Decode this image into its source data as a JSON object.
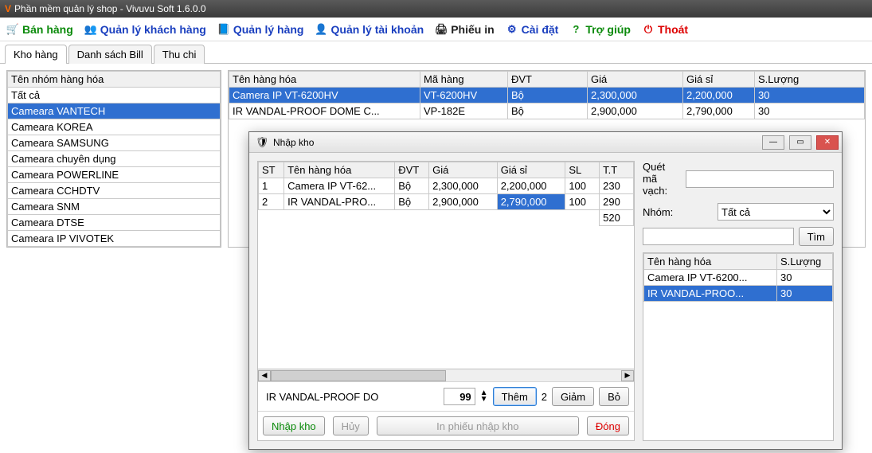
{
  "window": {
    "title": "Phần mềm quản lý shop - Vivuvu Soft 1.6.0.0"
  },
  "toolbar": {
    "sell": "Bán hàng",
    "customers": "Quản lý khách hàng",
    "inventory": "Quản lý hàng",
    "accounts": "Quản lý tài khoản",
    "printslip": "Phiếu in",
    "settings": "Cài đặt",
    "help": "Trợ giúp",
    "exit": "Thoát"
  },
  "tabs": {
    "warehouse": "Kho hàng",
    "bills": "Danh sách Bill",
    "cash": "Thu chi"
  },
  "groups": {
    "header": "Tên nhóm hàng hóa",
    "items": [
      "Tất cả",
      "Cameara VANTECH",
      "Cameara KOREA",
      "Cameara SAMSUNG",
      "Cameara chuyên dụng",
      "Cameara POWERLINE",
      "Cameara CCHDTV",
      "Cameara SNM",
      "Cameara DTSE",
      "Cameara IP VIVOTEK"
    ],
    "selected_index": 1
  },
  "products_table": {
    "headers": {
      "name": "Tên hàng hóa",
      "code": "Mã hàng",
      "unit": "ĐVT",
      "price": "Giá",
      "wprice": "Giá sỉ",
      "qty": "S.Lượng"
    },
    "rows": [
      {
        "name": "Camera IP VT-6200HV",
        "code": "VT-6200HV",
        "unit": "Bộ",
        "price": "2,300,000",
        "wprice": "2,200,000",
        "qty": "30",
        "selected": true
      },
      {
        "name": "IR VANDAL-PROOF DOME C...",
        "code": "VP-182E",
        "unit": "Bộ",
        "price": "2,900,000",
        "wprice": "2,790,000",
        "qty": "30",
        "selected": false
      }
    ]
  },
  "import_dialog": {
    "title": "Nhập kho",
    "grid": {
      "headers": {
        "st": "ST",
        "name": "Tên hàng hóa",
        "unit": "ĐVT",
        "price": "Giá",
        "wprice": "Giá sỉ",
        "sl": "SL",
        "tt": "T.T"
      },
      "rows": [
        {
          "st": "1",
          "name": "Camera IP VT-62...",
          "unit": "Bộ",
          "price": "2,300,000",
          "wprice": "2,200,000",
          "sl": "100",
          "tt": "230"
        },
        {
          "st": "2",
          "name": "IR VANDAL-PRO...",
          "unit": "Bộ",
          "price": "2,900,000",
          "wprice": "2,790,000",
          "sl": "100",
          "tt": "290"
        }
      ],
      "footer_total": "520",
      "selected_cell": {
        "row": 1,
        "col": "wprice"
      }
    },
    "add_row": {
      "product_text": "IR VANDAL-PROOF DO",
      "qty_value": "99",
      "step_label": "2",
      "btn_add": "Thêm",
      "btn_dec": "Giảm",
      "btn_remove": "Bỏ"
    },
    "bottom": {
      "btn_import": "Nhập kho",
      "btn_cancel": "Hủy",
      "btn_print": "In phiếu nhập kho",
      "btn_close": "Đóng"
    },
    "side": {
      "scan_label": "Quét mã vạch:",
      "group_label": "Nhóm:",
      "group_value": "Tất cả",
      "search_btn": "Tìm",
      "list_headers": {
        "name": "Tên hàng hóa",
        "qty": "S.Lượng"
      },
      "list_rows": [
        {
          "name": "Camera IP VT-6200...",
          "qty": "30",
          "selected": false
        },
        {
          "name": "IR VANDAL-PROO...",
          "qty": "30",
          "selected": true
        }
      ]
    }
  }
}
